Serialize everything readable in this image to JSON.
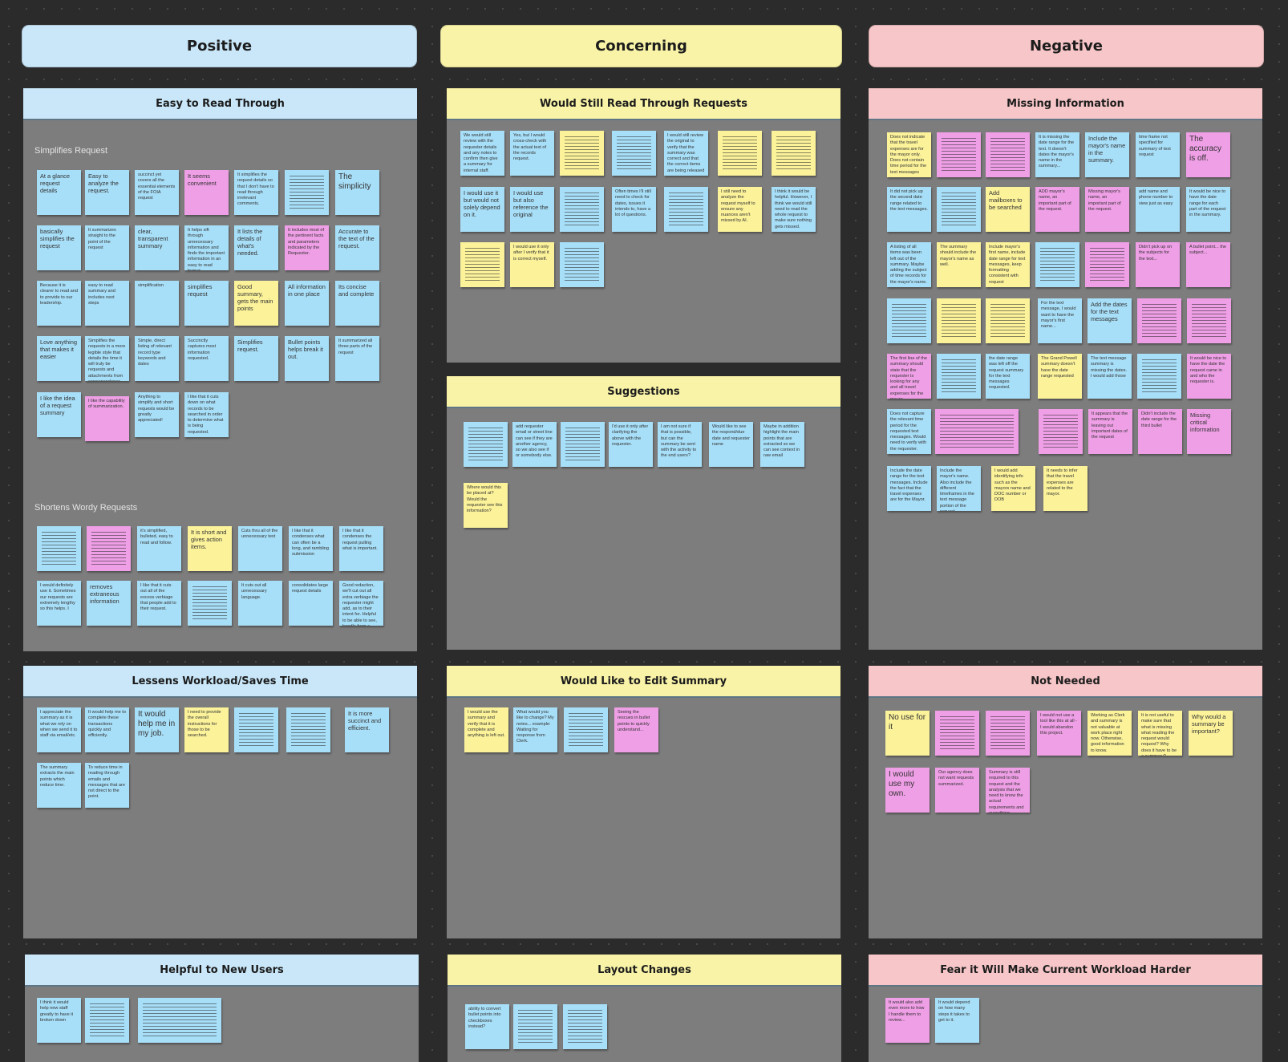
{
  "columns": [
    {
      "label": "Positive",
      "color": "#c9e7f9"
    },
    {
      "label": "Concerning",
      "color": "#f9f3a7"
    },
    {
      "label": "Negative",
      "color": "#f7c6c8"
    }
  ],
  "sections": [
    {
      "title": "Easy to Read Through"
    },
    {
      "title": "Would Still Read Through Requests"
    },
    {
      "title": "Missing Information"
    },
    {
      "title": "Lessens Workload/Saves Time"
    },
    {
      "title": "Suggestions"
    },
    {
      "title": "Would Like to Edit Summary"
    },
    {
      "title": "Not Needed"
    },
    {
      "title": "Helpful to New Users"
    },
    {
      "title": "Layout Changes"
    },
    {
      "title": "Fear it Will Make Current Workload Harder"
    }
  ],
  "sublabels": [
    "Simplifies Request",
    "Shortens Wordy Requests"
  ],
  "notes": {
    "n1": "At a glance request details",
    "n2": "Easy to analyze the request.",
    "n3": "succinct yet covers all the essential elements of the FOIA request",
    "n4": "It seems convenient",
    "n5": "It simplifies the request details so that I don't have to read through irrelevant comments.",
    "n6": "The simplicity",
    "n7": "basically simplifies the request",
    "n8": "It summarizes straight to the point of the request",
    "n9": "clear, transparent summary",
    "n10": "It helps sift through unnecessary information and finds the important information in an easy to read format.",
    "n11": "It lists the details of what's needed.",
    "n12": "It includes most of the pertinent facts and parameters indicated by the Requester.",
    "n13": "Accurate to the text of the request.",
    "n14": "Because it is clearer to read and to provide to our leadership.",
    "n15": "easy to read summary and includes next steps",
    "n16": "simplification",
    "n17": "simplifies request",
    "n18": "Good summary, gets the main points",
    "n19": "All information in one place",
    "n20": "Its concise and complete",
    "n21": "Love anything that makes it easier",
    "n22": "Simplifies the requests in a more legible style that details the time it will truly be requests and attachments from correspondence",
    "n23": "Simple, direct listing of relevant record type keywords and dates",
    "n24": "Succinctly captures most information requested.",
    "n25": "Simplifies request.",
    "n26": "Bullet points helps break it out.",
    "n27": "It summarized all three parts of the request",
    "n28": "I like the idea of a request summary",
    "n29": "I like the capability of summarization.",
    "n30": "Anything to simplify and short requests would be greatly appreciated!",
    "n31": "I like that it cuts down on what records to be searched in order to determine what is being requested.",
    "n32": "it's simplified, bulleted, easy to read and follow.",
    "n33": "It is short and gives action items.",
    "n34": "Cuts thru all of the unnecessary text",
    "n35": "I like that it condenses what can often be a long, and rambling submission",
    "n36": "I like that it condenses the request pulling what is important.",
    "n37": "I would definitely use it. Sometimes our requests are extremely lengthy so this helps. I",
    "n38": "removes extraneous information",
    "n39": "I like that it cuts out all of the excess verbiage that people add to their request.",
    "n40": "It cuts out all unnecessary language.",
    "n41": "consolidates large request details",
    "n42": "Good redaction, we'll cut out all extra verbiage the requester might add, as to their intent for. Helpful to be able to see, handle from a prompt and more reviews.",
    "n43": "I appreciate the summary as it is what we rely on when we send it to staff via email/etc.",
    "n44": "It would help me to complete these transactions quickly and efficiently.",
    "n45": "It would help me in my job.",
    "n46": "I need to provide the overall instructions for those to be searched.",
    "n47": "It is more succinct and efficient.",
    "n48": "The summary extracts the main points which reduce time.",
    "n49": "To reduce time in reading through emails and messages that are not direct to the point.",
    "n50": "I think it would help new staff greatly to have it broken down",
    "c1": "We would still review with the requester details and any notes to confirm then give a summary for internal staff.",
    "c2": "Yes, but I would cross-check with the actual text of the records request.",
    "c3": "I would still review the original to verify that the summary was correct and that the correct items are being released",
    "c4": "I would use it but would not solely depend on it.",
    "c5": "I would use but also reference the original",
    "c6": "Often times I'll still need to check for dates, issues it intends to, have a lot of questions.",
    "c7": "I still need to analyze the request myself to ensure any nuances aren't missed by AI.",
    "c8": "I think it would be helpful. However, I think we would still need to read the whole request to make sure nothing gets missed.",
    "c9": "I would use it only after I verify that it is correct myself.",
    "c10": "add requester email or street line can see if they are another agency, so we also see if or somebody else.",
    "c11": "I'd use it only after clarifying the above with the requester.",
    "c12": "I am not sure if that is possible, but can the summary be sent with the activity to the end users?",
    "c13": "Would like to see the respond/due date and requester name",
    "c14": "Maybe in addition highlight the main points that are extracted so we can see context in raw email",
    "c15": "Where would this be placed at? Would the requester see this information?",
    "c16": "I would use the summary and verify that it is complete and anything is left out.",
    "c17": "What would you like to change? My notes... example: Waiting for response from Clerk.",
    "c18": "Seeing the rescues in bullet points to quickly understand...",
    "c19": "ability to convert bullet points into checkboxes instead?",
    "g1": "Does not indicate that the travel expenses are for the mayor only. Does not contain time period for the text messages",
    "g2": "It is missing the date range for the text. It doesn't dates the mayor's name in the summary...",
    "g3": "Include the mayor's name in the summary.",
    "g4": "time frame not specified for summary of text request",
    "g5": "The accuracy is off.",
    "g6": "It did not pick up the second date range related to the text messages.",
    "g7": "Add mailboxes to be searched",
    "g8": "ADD mayor's name, an important part of the request.",
    "g9": "Missing mayor's name, an important part of the request.",
    "g10": "add name and phone number to view just as easy",
    "g11": "It would be nice to have the date range for each part of the request in the summary.",
    "g12": "A listing of all items was been left out of the summary. Maybe adding the subject of time records for the mayor's name.",
    "g13": "The summary should include the mayor's name as well.",
    "g14": "Include mayor's first name, include date range for text messages, keep formatting consistent with request",
    "g15": "Didn't pick up on the subjects for the text...",
    "g16": "A bullet point... the subject...",
    "g17": "For the text message, I would want to have the mayor's first name...",
    "g18": "Add the dates for the text messages",
    "g19": "The first line of the summary should state that the requester is looking for any and all travel expenses for the mayor...",
    "g20": "the date range was left off the request summary for the text messages requested.",
    "g21": "The Grand Powell summary doesn't have the date range requested",
    "g22": "The text message summary is missing the dates. I would add those",
    "g23": "It would be nice to have the date the request came in and who the requester is.",
    "g24": "Does not capture the relevant time period for the requested text messages. Would need to verify with the requester.",
    "g25": "It appears that the summary is leaving out important dates of the request",
    "g26": "Didn't include the date range for the third bullet",
    "g27": "Missing critical information",
    "g28": "Include the date range for the text messages. Include the fact that the travel expenses are for the Mayor.",
    "g29": "Include the mayor's name. Also include the different timeframes in the text message portion of the request.",
    "g30": "I would add identifying info such as the mayors name and DOC number or DOB",
    "g31": "It needs to infer that the travel expenses are related to the mayor.",
    "g32": "No use for it",
    "g33": "I would not use a tool like this at all - I would abandon this project.",
    "g34": "Working as Clerk and summary is not valuable at work place right now. Otherwise, good information to know.",
    "g35": "It is not useful to make sure that what is missing what reading the request would request? Why does it have to be a summary?",
    "g36": "Why would a summary be important?",
    "g37": "I would use my own.",
    "g38": "Our agency does not want requests summarized.",
    "g39": "Summary is still required to this request and the analysis that we need to know the actual requirements and everything.",
    "g40": "It would also add even more to how I handle them to review...",
    "g41": "It would depend on how many steps it takes to get to it."
  }
}
